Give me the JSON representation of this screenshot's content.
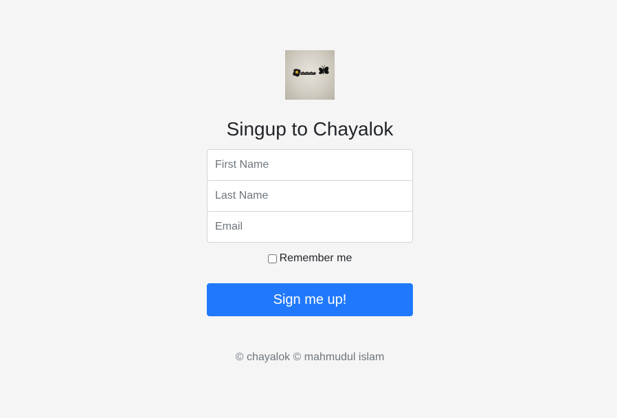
{
  "logo": {
    "alt": "chayalok logo",
    "text": "ছায়ালোক"
  },
  "heading": "Singup to Chayalok",
  "form": {
    "first_name": {
      "placeholder": "First Name",
      "value": ""
    },
    "last_name": {
      "placeholder": "Last Name",
      "value": ""
    },
    "email": {
      "placeholder": "Email",
      "value": ""
    },
    "remember_label": "Remember me",
    "remember_checked": false,
    "submit_label": "Sign me up!"
  },
  "footer": "© chayalok © mahmudul islam",
  "colors": {
    "background": "#f5f5f5",
    "primary_button": "#2079fd"
  }
}
